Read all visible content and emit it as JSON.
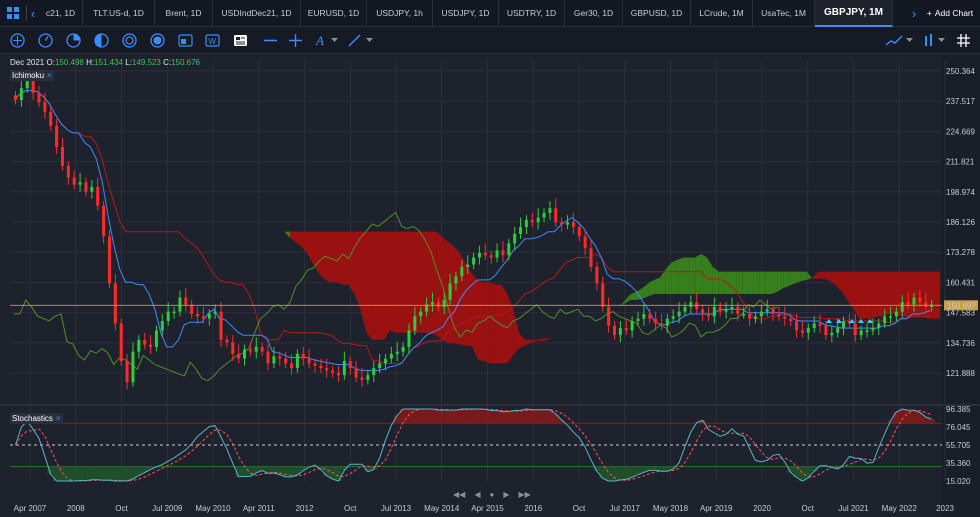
{
  "tabbar": {
    "tabs": [
      {
        "label": "c21, 1D",
        "w": 44
      },
      {
        "label": "TLT.US-d, 1D",
        "w": 72
      },
      {
        "label": "Brent, 1D",
        "w": 58
      },
      {
        "label": "USDIndDec21, 1D",
        "w": 88
      },
      {
        "label": "EURUSD, 1D",
        "w": 66
      },
      {
        "label": "USDJPY, 1h",
        "w": 66
      },
      {
        "label": "USDJPY, 1D",
        "w": 66
      },
      {
        "label": "USDTRY, 1D",
        "w": 66
      },
      {
        "label": "Ger30, 1D",
        "w": 58
      },
      {
        "label": "GBPUSD, 1D",
        "w": 68
      },
      {
        "label": "LCrude, 1M",
        "w": 62
      },
      {
        "label": "UsaTec, 1M",
        "w": 62
      },
      {
        "label": "GBPJPY, 1M",
        "w": 78,
        "active": true
      }
    ],
    "add_chart": "Add Chart"
  },
  "legend": {
    "period": "Dec 2021",
    "o_label": "O:",
    "o": "150.498",
    "h_label": "H:",
    "h": "151.434",
    "l_label": "L:",
    "l": "149.523",
    "c_label": "C:",
    "c": "150.676"
  },
  "indicators": {
    "ichimoku": "Ichimoku",
    "stochastics": "Stochastics"
  },
  "current_price": "150.697",
  "colors": {
    "up": "#2ecc40",
    "down": "#ff2a2a",
    "cloud_up": "#3a8a1c",
    "cloud_down": "#a8100f",
    "tenkan": "#3b8cff",
    "kijun": "#b31a1a",
    "chikou": "#4f8f2a",
    "stoch_k": "#5ab4c8",
    "stoch_d": "#ff5050"
  },
  "chart_data": {
    "type": "candlestick",
    "symbol": "GBPJPY",
    "timeframe": "1M",
    "y_ticks": [
      "250.364",
      "237.517",
      "224.669",
      "211.821",
      "198.974",
      "186.126",
      "173.278",
      "160.431",
      "147.583",
      "134.736",
      "121.888"
    ],
    "ylim": [
      110,
      255
    ],
    "x_ticks": [
      "Apr 2007",
      "2008",
      "Oct",
      "Jul 2009",
      "May 2010",
      "Apr 2011",
      "2012",
      "Oct",
      "Jul 2013",
      "May 2014",
      "Apr 2015",
      "2016",
      "Oct",
      "Jul 2017",
      "May 2018",
      "Apr 2019",
      "2020",
      "Oct",
      "Jul 2021",
      "May 2022",
      "2023"
    ],
    "stoch_ticks": [
      "96.385",
      "76.045",
      "55.705",
      "35.360",
      "15.020"
    ],
    "stoch_levels": {
      "overbought": 80,
      "mid": 50,
      "oversold": 20
    },
    "close_series": [
      238,
      243,
      246,
      241,
      237,
      233,
      227,
      218,
      210,
      205,
      202,
      203,
      199,
      201,
      193,
      180,
      160,
      143,
      127,
      118,
      131,
      136,
      134,
      133,
      140,
      144,
      148,
      148,
      154,
      151,
      147,
      146,
      145,
      147,
      148,
      136,
      135,
      130,
      128,
      132,
      131,
      133,
      131,
      126,
      129,
      128,
      126,
      124,
      130,
      128,
      126,
      125,
      124,
      123,
      122,
      121,
      127,
      124,
      120,
      119,
      121,
      124,
      126,
      128,
      130,
      131,
      133,
      140,
      146,
      148,
      151,
      152,
      150,
      153,
      160,
      163,
      167,
      168,
      171,
      173,
      172,
      171,
      174,
      172,
      177,
      181,
      184,
      187,
      186,
      188,
      190,
      192,
      186,
      185,
      186,
      184,
      180,
      175,
      167,
      160,
      150,
      142,
      138,
      141,
      140,
      144,
      145,
      147,
      145,
      143,
      142,
      145,
      146,
      148,
      150,
      152,
      149,
      147,
      146,
      150,
      148,
      149,
      150,
      147,
      147,
      145,
      146,
      148,
      149,
      147,
      146,
      145,
      144,
      140,
      139,
      141,
      143,
      142,
      138,
      139,
      141,
      144,
      143,
      138,
      140,
      140,
      141,
      143,
      146,
      146,
      148,
      152,
      151,
      154,
      152,
      150,
      151
    ]
  }
}
